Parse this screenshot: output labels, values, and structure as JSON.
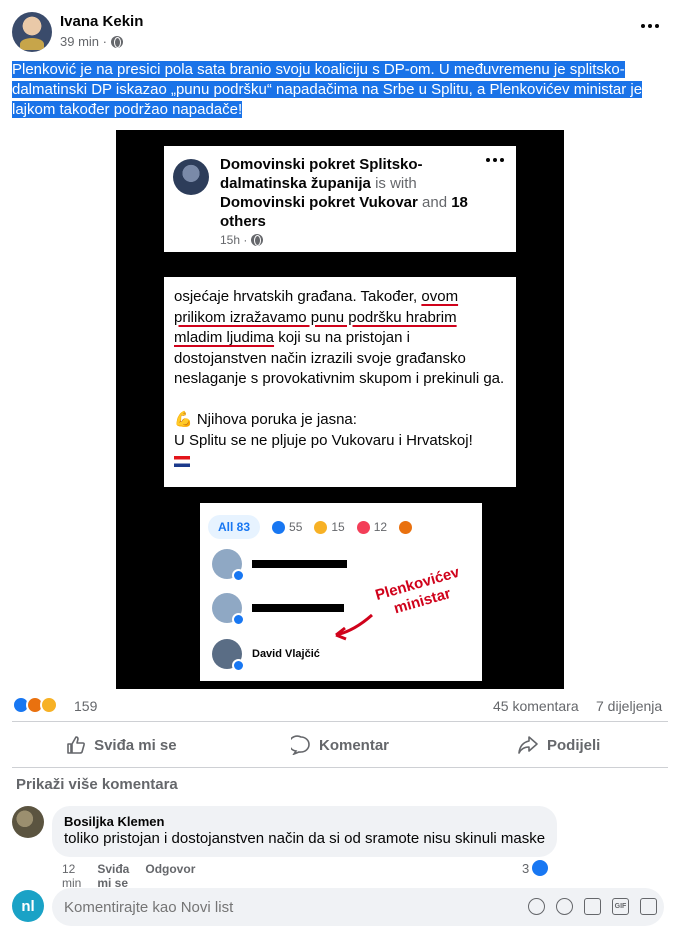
{
  "post": {
    "author": "Ivana Kekin",
    "time": "39 min ·",
    "text": "Plenković je na presici pola sata branio svoju koaliciju s DP-om. U međuvremenu je splitsko-dalmatinski DP iskazao „punu podršku“ napadačima na Srbe u Splitu, a Plenkovićev ministar je lajkom također podržao napadače!"
  },
  "embedded": {
    "page_name": "Domovinski pokret Splitsko-dalmatinska županija",
    "is_with": "is with",
    "with_page": "Domovinski pokret Vukovar",
    "and": "and",
    "others": "18 others",
    "time": "15h ·",
    "body_1": "osjećaje hrvatskih građana. Također,",
    "body_u1": "ovom prilikom izražavamo punu podršku hrabrim mladim ljudima",
    "body_2": "koji su na pristojan i dostojanstven način izrazili svoje građansko neslaganje s provokativnim skupom i prekinuli ga.",
    "body_3": "💪 Njihova poruka je jasna:",
    "body_4": "U Splitu se ne pljuje po Vukovaru i Hrvatskoj!",
    "reactions": {
      "all_label": "All 83",
      "like": "55",
      "care": "15",
      "love": "12"
    },
    "reactor_name": "David Vlajčić",
    "annotation": "Plenkovićev ministar"
  },
  "stats": {
    "reactions": "159",
    "comments": "45 komentara",
    "shares": "7 dijeljenja"
  },
  "actions": {
    "like": "Sviđa mi se",
    "comment": "Komentar",
    "share": "Podijeli"
  },
  "more_comments": "Prikaži više komentara",
  "comment": {
    "author": "Bosiljka Klemen",
    "text": "toliko pristojan i dostojanstven način da si od sramote nisu skinuli maske",
    "time": "12 min",
    "like": "Sviđa mi se",
    "reply": "Odgovor",
    "likes": "3"
  },
  "composer": {
    "avatar_text": "nl",
    "placeholder": "Komentirajte kao Novi list"
  },
  "colors": {
    "accent": "#1877f2",
    "highlight": "#1a73e8",
    "annotation": "#d0021b"
  }
}
